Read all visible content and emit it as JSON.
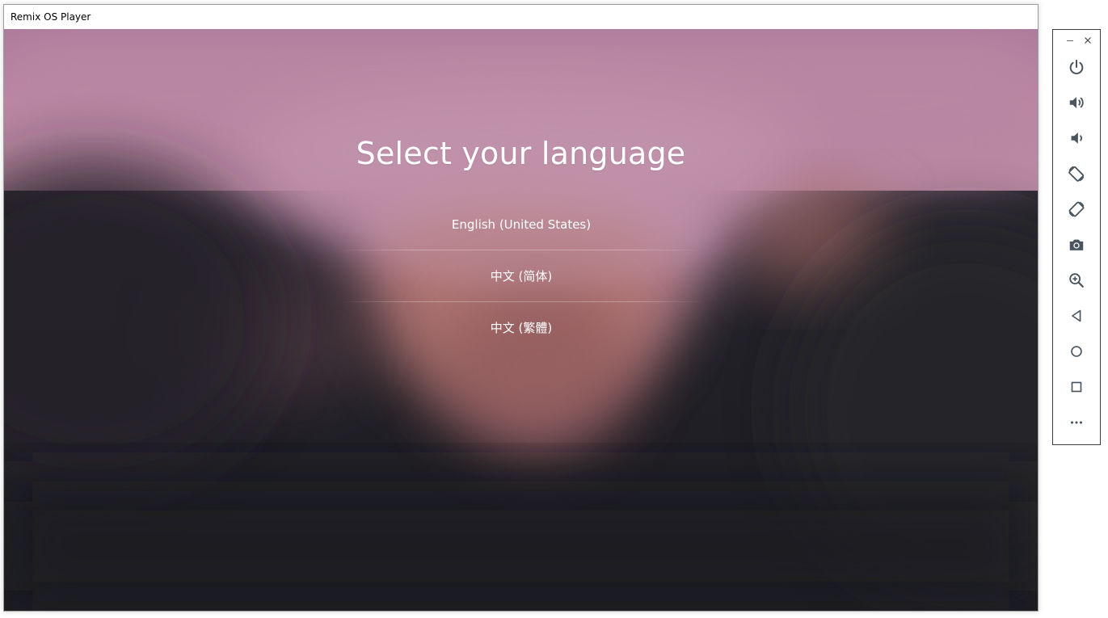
{
  "window": {
    "title": "Remix OS Player"
  },
  "screen": {
    "headline": "Select your language",
    "languages": [
      {
        "label": "English (United States)"
      },
      {
        "label": "中文 (简体)"
      },
      {
        "label": "中文 (繁體)"
      }
    ]
  },
  "toolbar": {
    "controls": [
      "minimize-icon",
      "close-icon"
    ],
    "buttons": [
      {
        "icon": "power-icon"
      },
      {
        "icon": "volume-up-icon"
      },
      {
        "icon": "volume-down-icon"
      },
      {
        "icon": "rotate-left-icon"
      },
      {
        "icon": "rotate-right-icon"
      },
      {
        "icon": "camera-icon"
      },
      {
        "icon": "zoom-in-icon"
      },
      {
        "icon": "back-icon"
      },
      {
        "icon": "home-icon"
      },
      {
        "icon": "recents-icon"
      },
      {
        "icon": "more-icon"
      }
    ],
    "icon_color": "#4a5560"
  }
}
